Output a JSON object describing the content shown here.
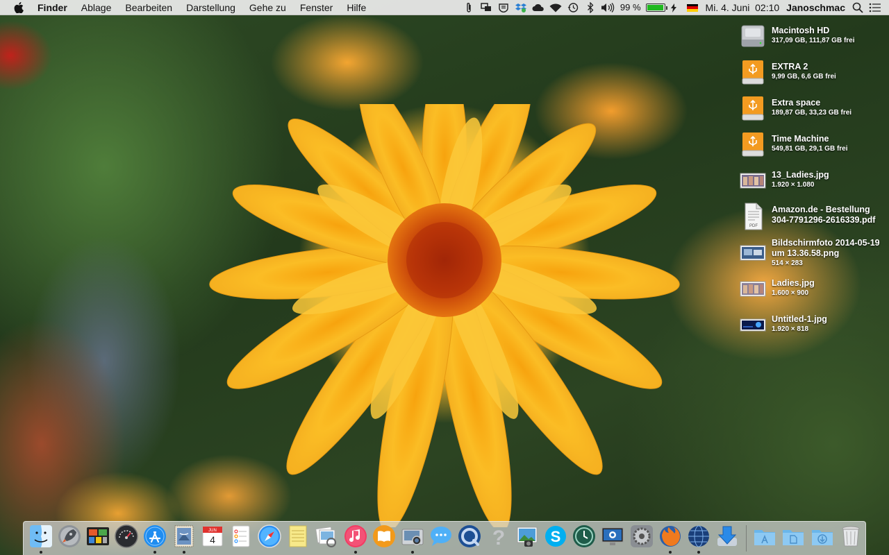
{
  "menubar": {
    "app_name": "Finder",
    "menus": [
      "Ablage",
      "Bearbeiten",
      "Darstellung",
      "Gehe zu",
      "Fenster",
      "Hilfe"
    ],
    "status_icons": [
      "paperclip-icon",
      "screen-share-icon",
      "shield-icon",
      "dropbox-icon",
      "cloud-icon",
      "wifi-icon",
      "time-machine-icon",
      "bluetooth-icon",
      "volume-icon"
    ],
    "battery_percent": "99 %",
    "battery_level": 0.99,
    "clock": "Mi. 4. Juni  02:10",
    "user": "Janoschmac"
  },
  "desktop": {
    "items": [
      {
        "name": "Macintosh HD",
        "info": "317,09 GB, 111,87 GB frei",
        "icon": "hard-drive-icon"
      },
      {
        "name": "EXTRA 2",
        "info": "9,99 GB, 6,6 GB frei",
        "icon": "usb-drive-icon"
      },
      {
        "name": "Extra space",
        "info": "189,87 GB, 33,23 GB frei",
        "icon": "usb-drive-icon"
      },
      {
        "name": "Time Machine",
        "info": "549,81 GB, 29,1 GB frei",
        "icon": "usb-drive-icon"
      },
      {
        "name": "13_Ladies.jpg",
        "info": "1.920 × 1.080",
        "icon": "image-thumbnail-icon"
      },
      {
        "name": "Amazon.de - Bestellung",
        "name2": "304-7791296-2616339.pdf",
        "info": "",
        "icon": "pdf-file-icon"
      },
      {
        "name": "Bildschirmfoto 2014-05-19",
        "name2": "um 13.36.58.png",
        "info": "514 × 283",
        "icon": "image-thumbnail-icon"
      },
      {
        "name": "Ladies.jpg",
        "info": "1.600 × 900",
        "icon": "image-thumbnail-icon"
      },
      {
        "name": "Untitled-1.jpg",
        "info": "1.920 × 818",
        "icon": "image-thumbnail-icon"
      }
    ]
  },
  "dock": {
    "calendar_month": "JUN",
    "calendar_day": "4",
    "apps": [
      "Finder",
      "Launchpad",
      "Mission Control",
      "Dashboard",
      "App Store",
      "Mail",
      "Calendar",
      "Reminders",
      "Safari",
      "Notes",
      "Preview",
      "iTunes",
      "iBooks",
      "Image Capture",
      "Messages",
      "QuickTime Player",
      "Help",
      "iPhoto",
      "Skype",
      "Time Machine",
      "Screen Sharing",
      "System Preferences",
      "Firefox",
      "Network Utility",
      "Downloads"
    ],
    "folders": [
      "Applications",
      "Documents",
      "Downloads",
      "Trash"
    ]
  }
}
